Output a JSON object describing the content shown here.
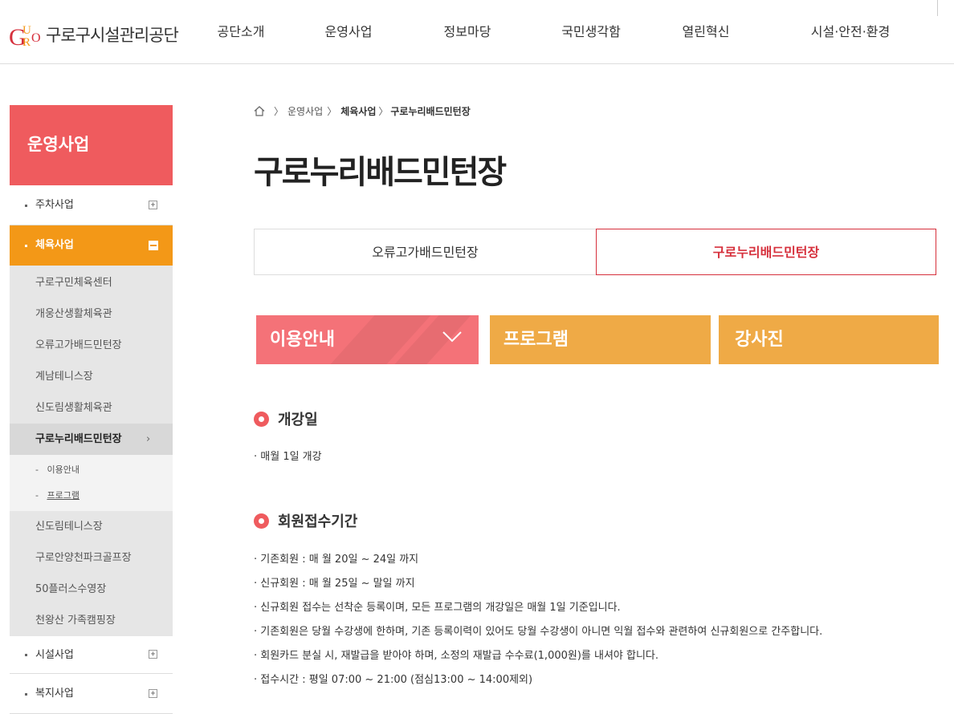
{
  "header": {
    "logo_text": "구로구시설관리공단",
    "nav": [
      "공단소개",
      "운영사업",
      "정보마당",
      "국민생각함",
      "열린혁신",
      "시설·안전·환경"
    ]
  },
  "sidebar": {
    "title": "운영사업",
    "items": [
      {
        "label": "주차사업",
        "toggle": "+"
      },
      {
        "label": "체육사업",
        "toggle": "-"
      },
      {
        "label": "시설사업",
        "toggle": "+"
      },
      {
        "label": "복지사업",
        "toggle": "+"
      }
    ],
    "sub_items": [
      "구로구민체육센터",
      "개웅산생활체육관",
      "오류고가배드민턴장",
      "계남테니스장",
      "신도림생활체육관",
      "구로누리배드민턴장"
    ],
    "sub_sub_items": [
      "이용안내",
      "프로그램"
    ],
    "sub_items_after": [
      "신도림테니스장",
      "구로안양천파크골프장",
      "50플러스수영장",
      "천왕산 가족캠핑장"
    ]
  },
  "breadcrumb": {
    "items": [
      "운영사업",
      "체육사업",
      "구로누리배드민턴장"
    ]
  },
  "page_title": "구로누리배드민턴장",
  "tabs": [
    "오류고가배드민턴장",
    "구로누리배드민턴장"
  ],
  "buttons": [
    "이용안내",
    "프로그램",
    "강사진"
  ],
  "sections": [
    {
      "heading": "개강일",
      "lines": [
        "· 매월 1일 개강"
      ]
    },
    {
      "heading": "회원접수기간",
      "lines": [
        "· 기존회원 : 매 월 20일 ~ 24일 까지",
        "· 신규회원 : 매 월 25일  ~  말일 까지",
        "· 신규회원 접수는 선착순 등록이며, 모든 프로그램의 개강일은 매월 1일 기준입니다.",
        "· 기존회원은 당월 수강생에 한하며, 기존 등록이력이 있어도 당월 수강생이 아니면 익월 접수와 관련하여 신규회원으로 간주합니다.",
        "· 회원카드 분실 시, 재발급을 받아야 하며, 소정의 재발급 수수료(1,000원)를 내셔야 합니다.",
        "· 접수시간 : 평일 07:00  ~  21:00 (점심13:00 ~ 14:00제외)"
      ]
    }
  ],
  "colors": {
    "accent": "#ef5b5e",
    "orange": "#f39817",
    "tab_active": "#d6303c",
    "btn_red": "#f47278",
    "btn_orange": "#efaa46"
  }
}
